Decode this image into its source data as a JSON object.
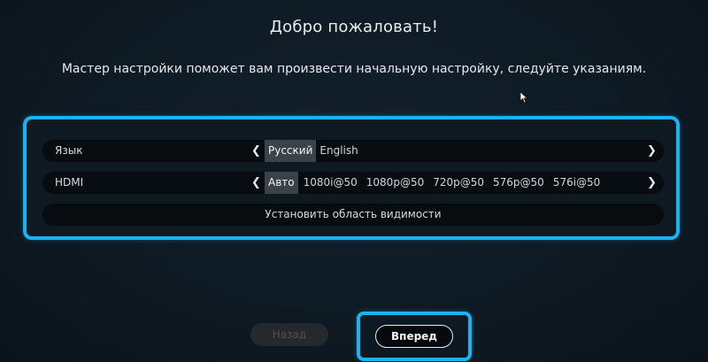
{
  "header": {
    "title": "Добро пожаловать!",
    "subtitle": "Мастер настройки поможет вам произвести начальную настройку, следуйте указаниям."
  },
  "settings": {
    "language": {
      "label": "Язык",
      "options": [
        "Русский",
        "English"
      ],
      "selected": "Русский"
    },
    "hdmi": {
      "label": "HDMI",
      "options": [
        "Авто",
        "1080i@50",
        "1080p@50",
        "720p@50",
        "576p@50",
        "576i@50"
      ],
      "selected": "Авто"
    },
    "visible_area": {
      "label": "Установить область видимости"
    }
  },
  "footer": {
    "back_label": "Назад",
    "next_label": "Вперед"
  },
  "icons": {
    "left": "chevron-left-icon",
    "right": "chevron-right-icon",
    "cursor": "mouse-cursor-icon"
  },
  "colors": {
    "focus_border": "#19b3f0",
    "background": "#0e1a24",
    "selected_option": "#3b4248"
  }
}
